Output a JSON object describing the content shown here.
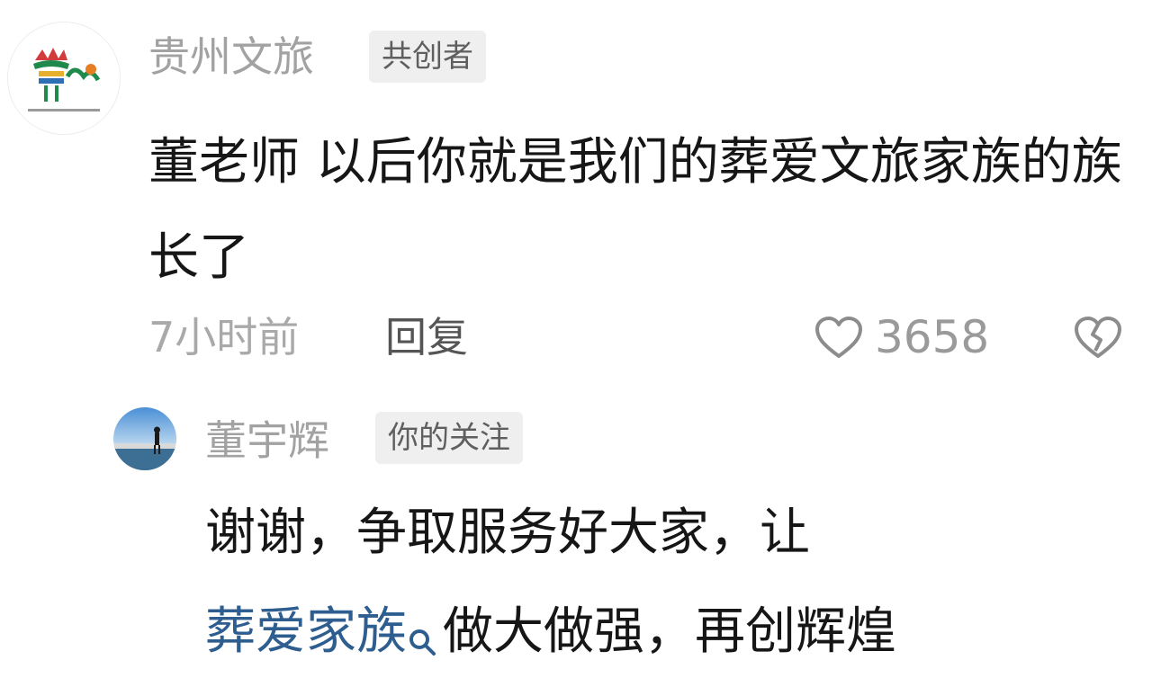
{
  "comment": {
    "author": "贵州文旅",
    "badge": "共创者",
    "text": "董老师 以后你就是我们的葬爱文旅家族的族长了",
    "time": "7小时前",
    "reply_label": "回复",
    "likes": "3658",
    "avatar_icon": "guizhou-tourism-logo",
    "like_icon": "heart-outline-icon",
    "dislike_icon": "broken-heart-icon"
  },
  "reply": {
    "author": "董宇辉",
    "badge": "你的关注",
    "line1": "谢谢，争取服务好大家，让",
    "tag": "葬爱家族",
    "line2_rest": "做大做强，再创辉煌",
    "avatar_icon": "user-photo-avatar",
    "search_icon": "search-icon"
  },
  "colors": {
    "muted": "#a2a2a2",
    "badge_bg": "#efefef",
    "link": "#2e5d8f",
    "text": "#161616"
  }
}
